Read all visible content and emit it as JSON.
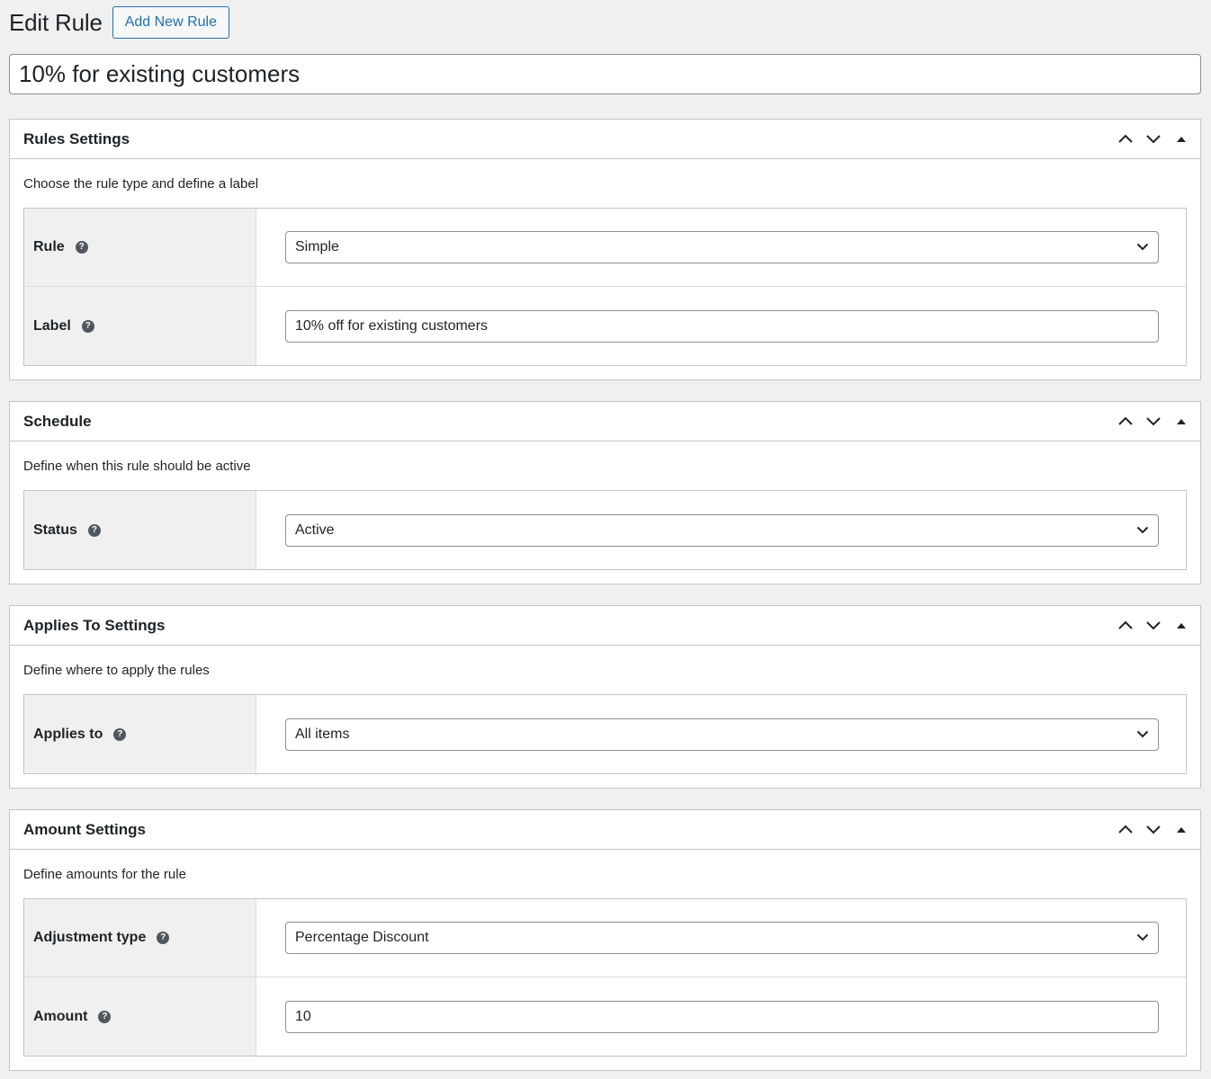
{
  "header": {
    "title": "Edit Rule",
    "add_new_label": "Add New Rule"
  },
  "rule_title": "10% for existing customers",
  "icons": {
    "move_up": "chevron-up-icon",
    "move_down": "chevron-down-icon",
    "toggle": "triangle-up-icon",
    "help": "question-circle-icon",
    "select_arrow": "chevron-down-icon"
  },
  "boxes": {
    "rules": {
      "title": "Rules Settings",
      "description": "Choose the rule type and define a label",
      "rule_label": "Rule",
      "rule_value": "Simple",
      "label_label": "Label",
      "label_value": "10% off for existing customers"
    },
    "schedule": {
      "title": "Schedule",
      "description": "Define when this rule should be active",
      "status_label": "Status",
      "status_value": "Active"
    },
    "applies": {
      "title": "Applies To Settings",
      "description": "Define where to apply the rules",
      "applies_label": "Applies to",
      "applies_value": "All items"
    },
    "amount": {
      "title": "Amount Settings",
      "description": "Define amounts for the rule",
      "adjustment_label": "Adjustment type",
      "adjustment_value": "Percentage Discount",
      "amount_label": "Amount",
      "amount_value": "10"
    }
  },
  "help_glyph": "?"
}
